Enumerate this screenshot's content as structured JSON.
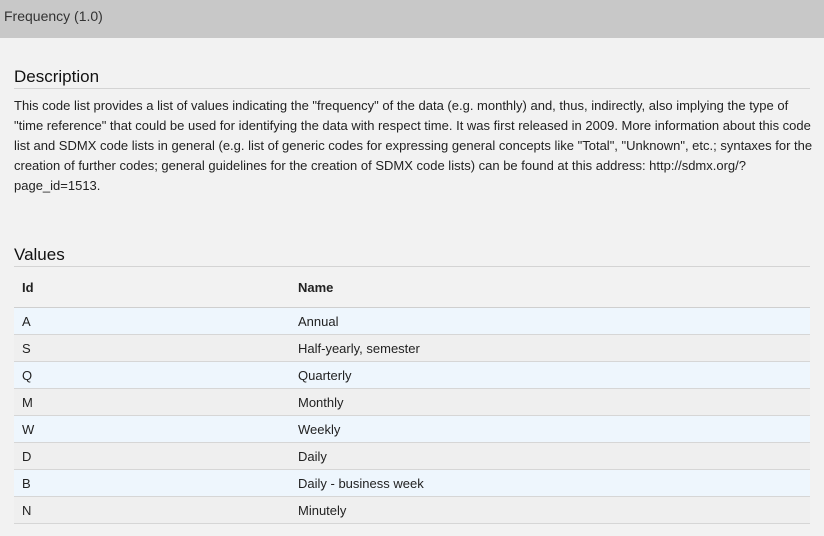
{
  "header": {
    "title": "Frequency (1.0)"
  },
  "description": {
    "heading": "Description",
    "text": "This code list provides a list of values indicating the \"frequency\" of the data (e.g. monthly) and, thus, indirectly, also implying the type of \"time reference\" that could be used for identifying the data with respect time. It was first released in 2009. More information about this code list and SDMX code lists in general (e.g. list of generic codes for expressing general concepts like \"Total\", \"Unknown\", etc.; syntaxes for the creation of further codes; general guidelines for the creation of SDMX code lists) can be found at this address: http://sdmx.org/?page_id=1513."
  },
  "values": {
    "heading": "Values",
    "columns": [
      "Id",
      "Name"
    ],
    "rows": [
      {
        "id": "A",
        "name": "Annual"
      },
      {
        "id": "S",
        "name": "Half-yearly, semester"
      },
      {
        "id": "Q",
        "name": "Quarterly"
      },
      {
        "id": "M",
        "name": "Monthly"
      },
      {
        "id": "W",
        "name": "Weekly"
      },
      {
        "id": "D",
        "name": "Daily"
      },
      {
        "id": "B",
        "name": "Daily - business week"
      },
      {
        "id": "N",
        "name": "Minutely"
      }
    ]
  }
}
